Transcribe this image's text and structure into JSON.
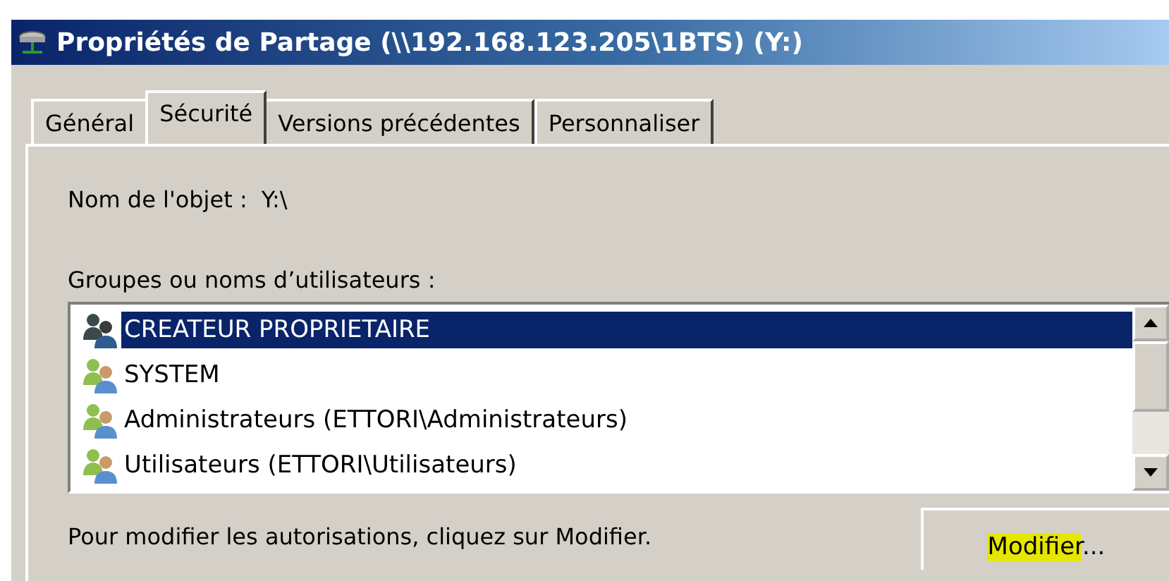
{
  "window": {
    "title": "Propriétés de Partage (\\\\192.168.123.205\\1BTS) (Y:)"
  },
  "tabs": [
    {
      "label": "Général",
      "selected": false
    },
    {
      "label": "Sécurité",
      "selected": true
    },
    {
      "label": "Versions précédentes",
      "selected": false
    },
    {
      "label": "Personnaliser",
      "selected": false
    }
  ],
  "object_name": {
    "label": "Nom de l'objet :",
    "value": "Y:\\"
  },
  "groups": {
    "label": "Groupes ou noms d’utilisateurs :",
    "items": [
      {
        "name": "CREATEUR PROPRIETAIRE",
        "selected": true
      },
      {
        "name": "SYSTEM",
        "selected": false
      },
      {
        "name": "Administrateurs (ETTORI\\Administrateurs)",
        "selected": false
      },
      {
        "name": "Utilisateurs (ETTORI\\Utilisateurs)",
        "selected": false
      }
    ]
  },
  "hint": "Pour modifier les autorisations, cliquez sur Modifier.",
  "edit_button": {
    "label_highlighted": "Modifier",
    "label_rest": "..."
  }
}
